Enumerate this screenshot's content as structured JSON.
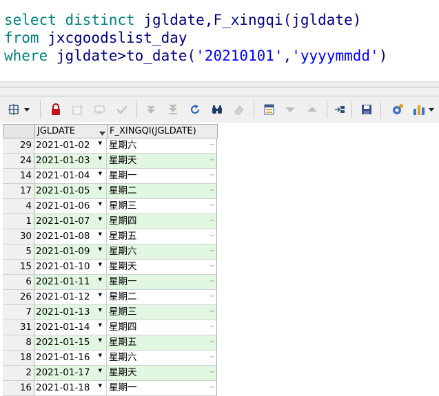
{
  "editor": {
    "line1": {
      "kw": "select distinct",
      "rest": " jgldate,F_xingqi(jgldate)"
    },
    "line2": {
      "kw": "from",
      "rest": " jxcgoodslist_day"
    },
    "line3": {
      "kw": "where",
      "rest": " jgldate>to_date(",
      "s1": "'20210101'",
      "comma": ",",
      "s2": "'yyyymmdd'",
      "close": ")"
    }
  },
  "toolbar": {
    "icons": [
      "grid-options-icon",
      "lock-icon",
      "insert-record-icon",
      "delete-record-icon",
      "post-changes-icon",
      "fetch-next-icon",
      "fetch-last-icon",
      "refresh-icon",
      "find-icon",
      "clear-icon",
      "query-by-example-icon",
      "previous-query-icon",
      "next-query-icon",
      "export-icon",
      "save-icon",
      "connect-icon",
      "chart-icon"
    ]
  },
  "grid": {
    "columns": [
      "JGLDATE",
      "F_XINGQI(JGLDATE)"
    ],
    "rows": [
      {
        "n": "29",
        "date": "2021-01-02",
        "day": "星期六"
      },
      {
        "n": "24",
        "date": "2021-01-03",
        "day": "星期天"
      },
      {
        "n": "14",
        "date": "2021-01-04",
        "day": "星期一"
      },
      {
        "n": "17",
        "date": "2021-01-05",
        "day": "星期二"
      },
      {
        "n": "4",
        "date": "2021-01-06",
        "day": "星期三"
      },
      {
        "n": "1",
        "date": "2021-01-07",
        "day": "星期四"
      },
      {
        "n": "30",
        "date": "2021-01-08",
        "day": "星期五"
      },
      {
        "n": "5",
        "date": "2021-01-09",
        "day": "星期六"
      },
      {
        "n": "15",
        "date": "2021-01-10",
        "day": "星期天"
      },
      {
        "n": "6",
        "date": "2021-01-11",
        "day": "星期一"
      },
      {
        "n": "26",
        "date": "2021-01-12",
        "day": "星期二"
      },
      {
        "n": "7",
        "date": "2021-01-13",
        "day": "星期三"
      },
      {
        "n": "31",
        "date": "2021-01-14",
        "day": "星期四"
      },
      {
        "n": "8",
        "date": "2021-01-15",
        "day": "星期五"
      },
      {
        "n": "18",
        "date": "2021-01-16",
        "day": "星期六"
      },
      {
        "n": "2",
        "date": "2021-01-17",
        "day": "星期天"
      },
      {
        "n": "16",
        "date": "2021-01-18",
        "day": "星期一"
      }
    ]
  }
}
